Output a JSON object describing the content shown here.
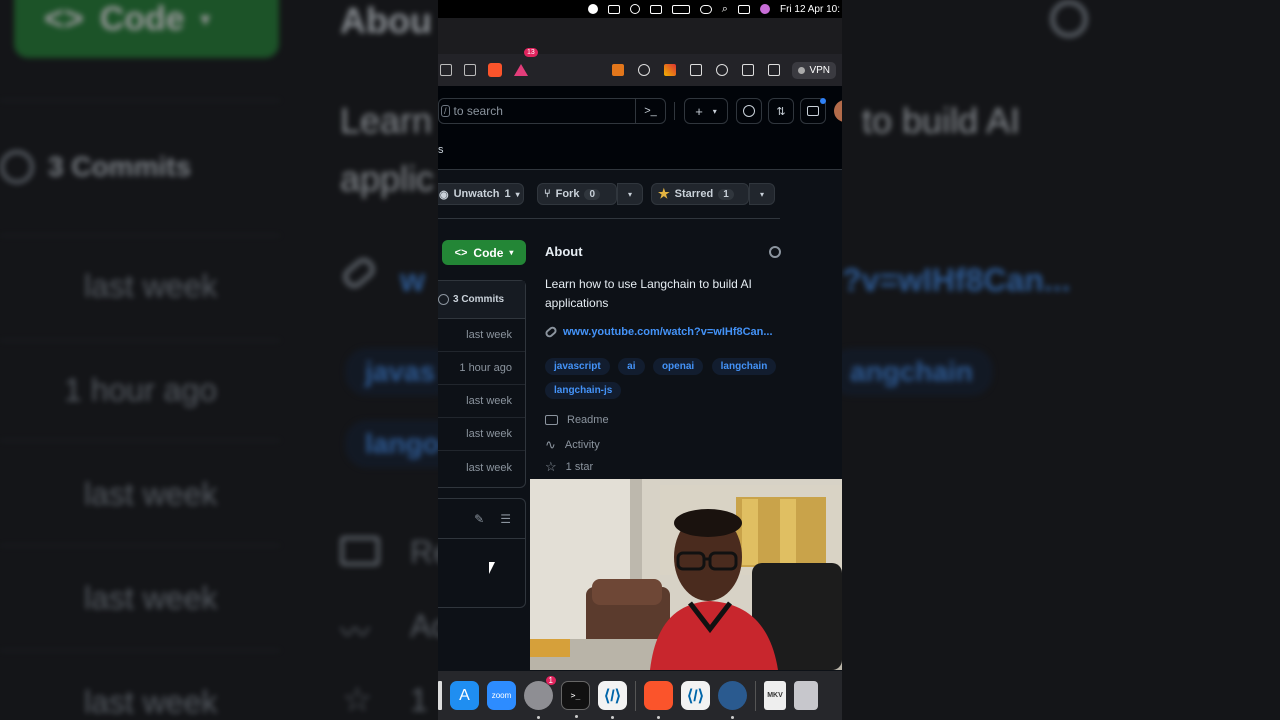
{
  "background": {
    "code_label": "Code",
    "commits_label": "3 Commits",
    "rows": [
      "last week",
      "1 hour ago",
      "last week",
      "last week",
      "last week"
    ],
    "about_partial": "Abou",
    "desc_partial_1": "Learn",
    "desc_partial_2": "applic",
    "desc_partial_3": "to build AI",
    "link_partial": "w",
    "link_partial_2": "?v=wIHf8Can...",
    "topic_partial_1": "javas",
    "topic_partial_2": "angchain",
    "topic_partial_3": "lango",
    "readme_partial": "Re",
    "activity_partial": "Ac",
    "star_partial": "1"
  },
  "menubar": {
    "datetime": "Fri 12 Apr  10:"
  },
  "browser": {
    "triangle_badge": "13",
    "vpn_label": "VPN"
  },
  "github_header": {
    "search_placeholder": "to search",
    "search_shortcut": "/",
    "command_glyph": ">_",
    "plus_label": "+",
    "repo_char": "s"
  },
  "repo_actions": {
    "unwatch_label": "Unwatch",
    "unwatch_count": "1",
    "fork_label": "Fork",
    "fork_count": "0",
    "starred_label": "Starred",
    "starred_count": "1"
  },
  "code_button": {
    "label": "Code"
  },
  "files": {
    "commits_label": "3 Commits",
    "rows": [
      "last week",
      "1 hour ago",
      "last week",
      "last week",
      "last week"
    ]
  },
  "about": {
    "title": "About",
    "description": "Learn how to use Langchain to build AI applications",
    "link": "www.youtube.com/watch?v=wIHf8Can...",
    "topics": [
      "javascript",
      "ai",
      "openai",
      "langchain",
      "langchain-js"
    ],
    "readme_label": "Readme",
    "activity_label": "Activity",
    "stars_label": "1 star"
  },
  "dock": {
    "zoom_label": "zoom",
    "settings_badge": "1",
    "terminal_glyph": ">_",
    "vlc_label": "MKV"
  },
  "colors": {
    "accent_blue": "#4493f8",
    "green_button": "#238636",
    "bg_dark": "#0d1117"
  }
}
